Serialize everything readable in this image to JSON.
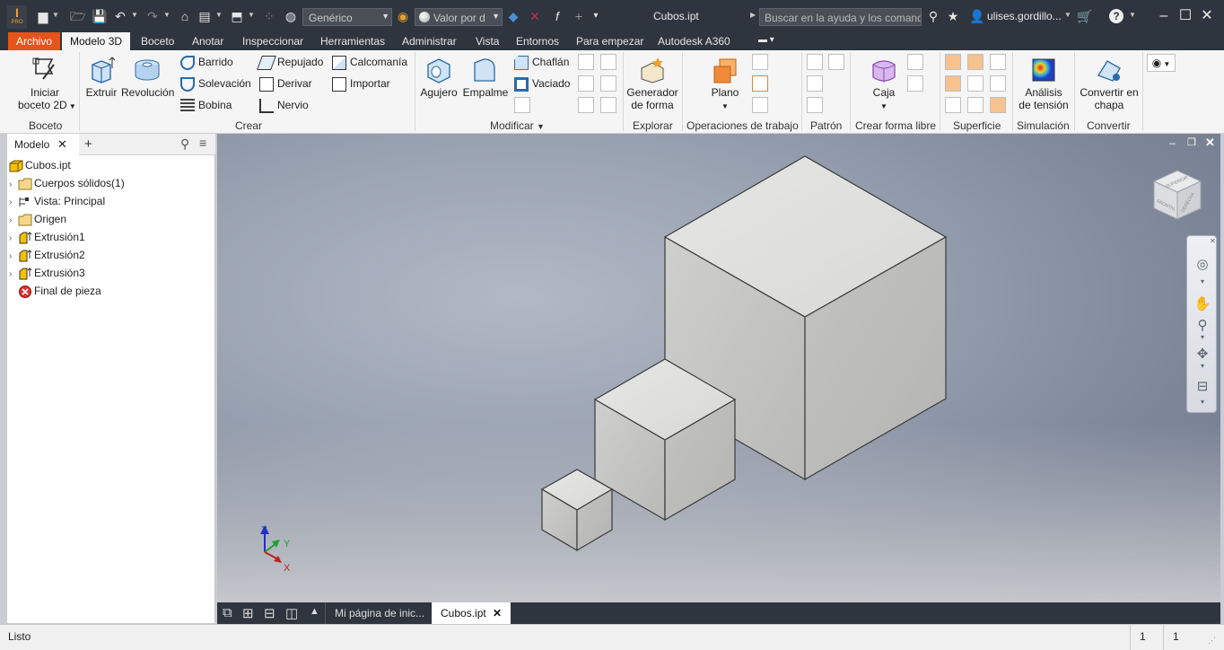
{
  "titlebar": {
    "app_badge": "I",
    "app_badge_sub": "PRO",
    "style": "Genérico",
    "appearance": "Valor por d",
    "doc_title": "Cubos.ipt",
    "search_placeholder": "Buscar en la ayuda y los comand",
    "user": "ulises.gordillo...",
    "icons": [
      "new-icon",
      "open-icon",
      "save-icon",
      "undo-icon",
      "redo-icon",
      "home-icon",
      "print-icon",
      "select-icon",
      "sketch-icon",
      "globe-icon",
      "material-icon",
      "appearance-icon",
      "clear-appearance-icon",
      "fx-icon",
      "plus-icon",
      "customize-icon",
      "search-arrow-icon",
      "star-icon",
      "user-icon",
      "cart-icon",
      "help-icon",
      "minimize-icon",
      "restore-icon",
      "close-icon"
    ]
  },
  "tabs": [
    "Archivo",
    "Modelo 3D",
    "Boceto",
    "Anotar",
    "Inspeccionar",
    "Herramientas",
    "Administrar",
    "Vista",
    "Entornos",
    "Para empezar",
    "Autodesk A360"
  ],
  "ribbon": {
    "boceto": {
      "label": "Boceto",
      "start_line1": "Iniciar",
      "start_line2": "boceto 2D"
    },
    "crear": {
      "label": "Crear",
      "extruir": "Extruir",
      "revolucion": "Revolución",
      "barrido": "Barrido",
      "solevacion": "Solevación",
      "bobina": "Bobina",
      "repujado": "Repujado",
      "derivar": "Derivar",
      "nervio": "Nervio",
      "calcomania": "Calcomanía",
      "importar": "Importar"
    },
    "modificar": {
      "label": "Modificar",
      "agujero": "Agujero",
      "empalme": "Empalme",
      "chaflan": "Chaflán",
      "vaciado": "Vaciado"
    },
    "explorar": {
      "label": "Explorar",
      "gen_line1": "Generador",
      "gen_line2": "de forma"
    },
    "operaciones": {
      "label": "Operaciones de trabajo",
      "plano": "Plano"
    },
    "patron": {
      "label": "Patrón"
    },
    "forma_libre": {
      "label": "Crear forma libre",
      "caja": "Caja"
    },
    "superficie": {
      "label": "Superficie"
    },
    "simulacion": {
      "label": "Simulación",
      "line1": "Análisis",
      "line2": "de tensión"
    },
    "convertir": {
      "label": "Convertir",
      "line1": "Convertir en",
      "line2": "chapa"
    }
  },
  "browser": {
    "tab": "Modelo",
    "root": "Cubos.ipt",
    "items": [
      "Cuerpos sólidos(1)",
      "Vista: Principal",
      "Origen",
      "Extrusión1",
      "Extrusión2",
      "Extrusión3",
      "Final de pieza"
    ]
  },
  "viewcube_labels": {
    "front": "FRONTAL",
    "right": "DERECHA",
    "top": "SUPERIOR"
  },
  "triad": {
    "x": "X",
    "y": "Y",
    "z": "Z"
  },
  "doctabs": {
    "home": "Mi página de inic...",
    "active": "Cubos.ipt"
  },
  "status": {
    "text": "Listo",
    "count1": "1",
    "count2": "1"
  },
  "colors": {
    "titlebar": "#2f353e",
    "archivo": "#e6541c",
    "accent": "#0696d7"
  }
}
